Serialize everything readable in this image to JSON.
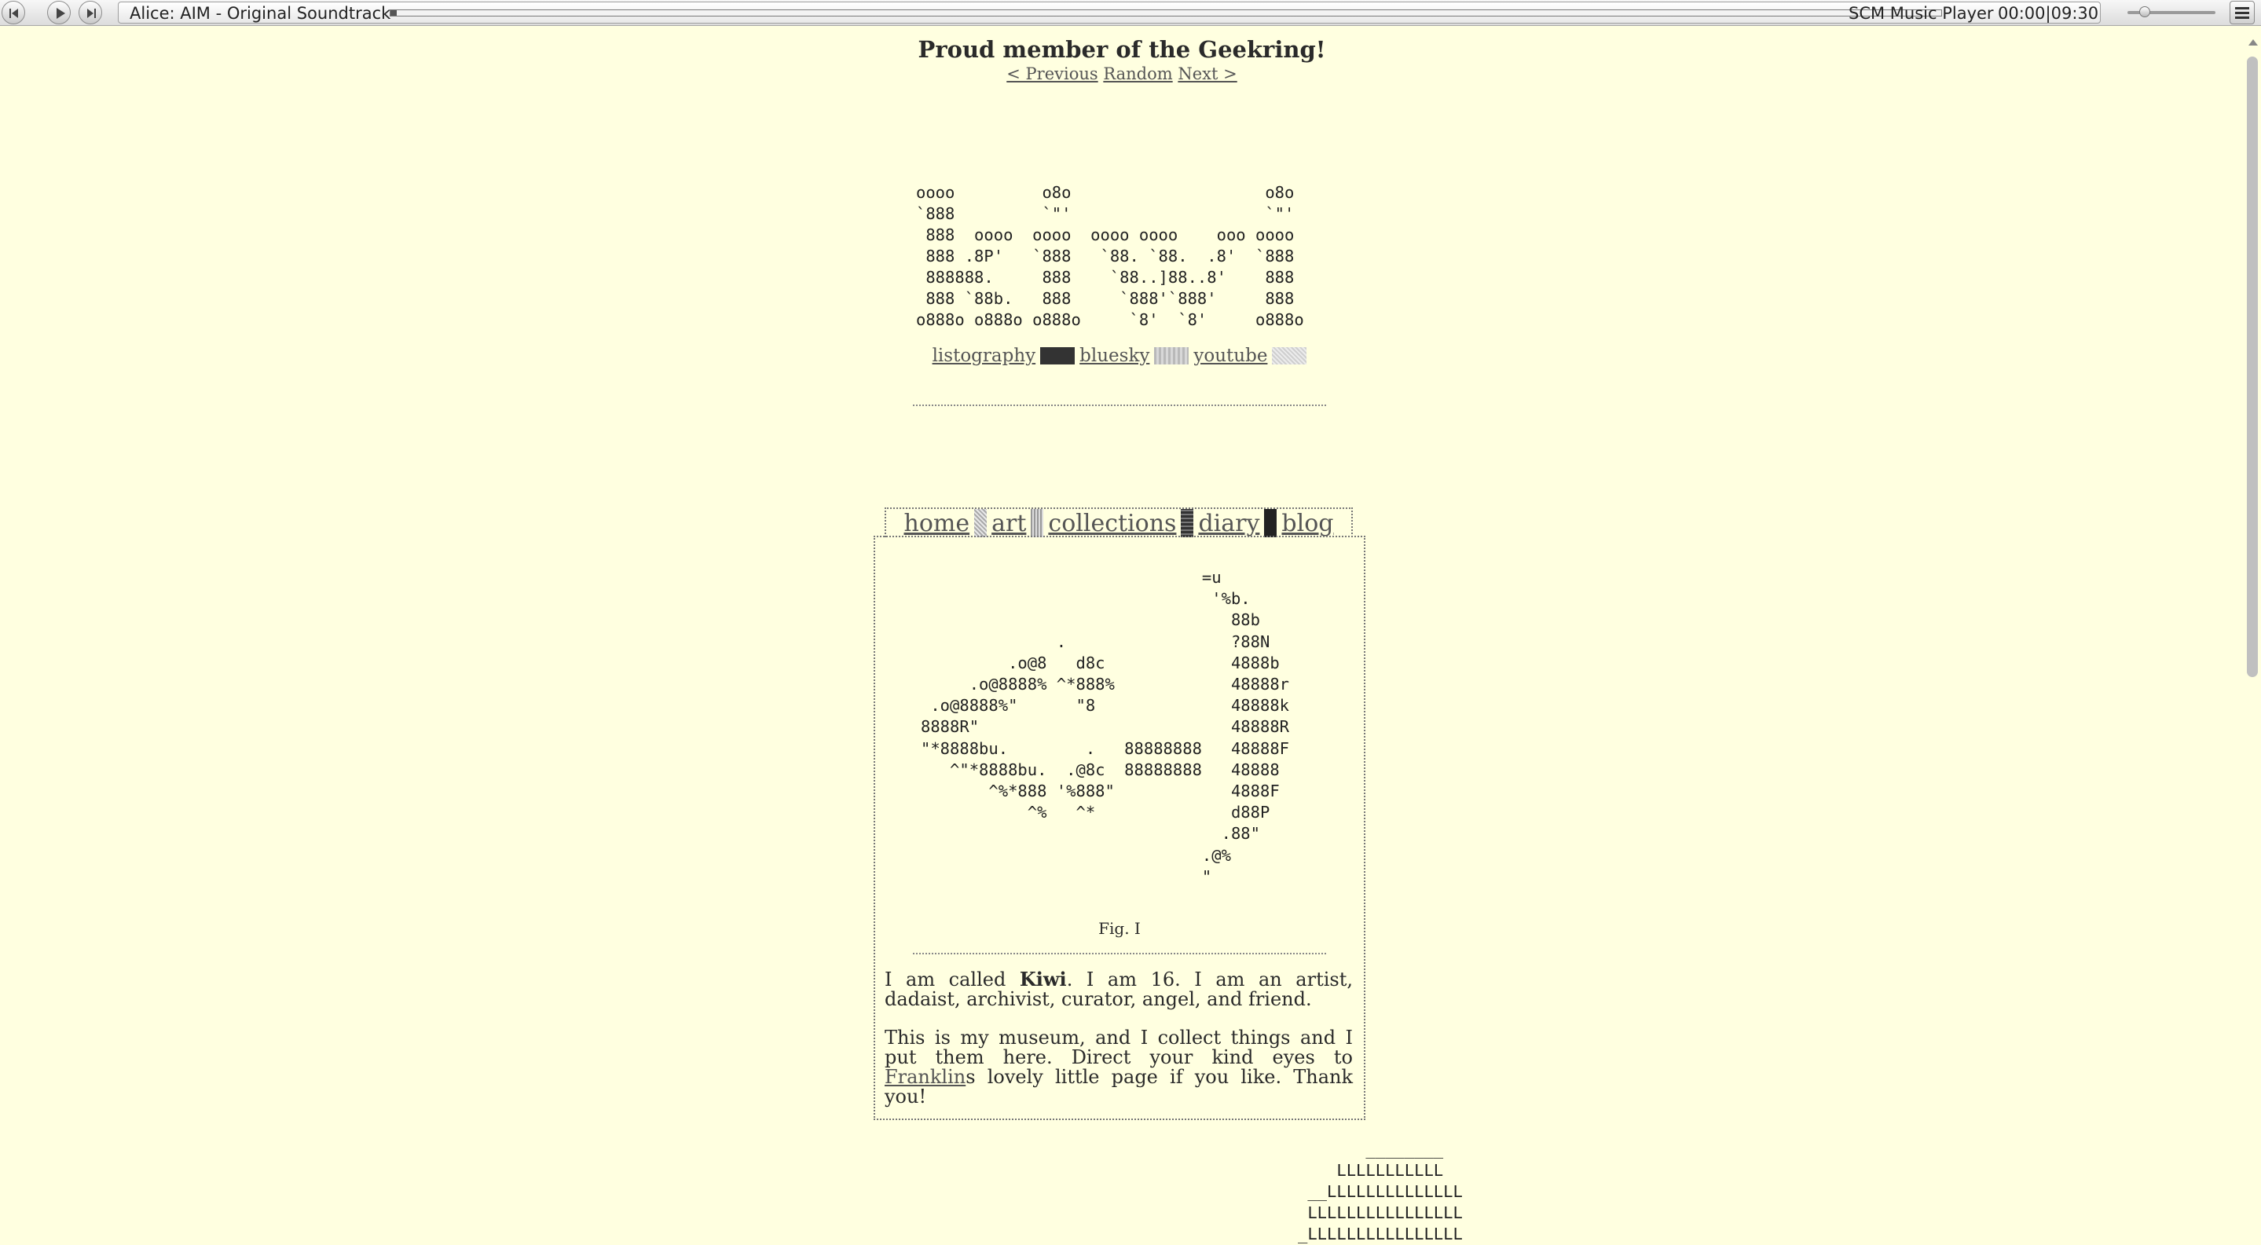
{
  "player": {
    "track_title": "Alice: AIM - Original Soundtrack",
    "player_name": "SCM Music Player",
    "time": "00:00|09:30",
    "progress_fraction": 0.004,
    "volume_fraction": 0.2
  },
  "geekring": {
    "title": "Proud member of the Geekring!",
    "previous": "< Previous",
    "random": "Random",
    "next": "Next >"
  },
  "logo_ascii": "oooo         o8o                    o8o\n`888         `\"'                    `\"'\n 888  oooo  oooo  oooo oooo    ooo oooo\n 888 .8P'   `888   `88. `88.  .8'  `888\n 888888.     888    `88..]88..8'    888\n 888 `88b.   888     `888'`888'     888\no888o o888o o888o     `8'  `8'     o888o",
  "social": {
    "links": [
      "listography",
      "bluesky",
      "youtube"
    ]
  },
  "nav": {
    "tabs": [
      "home",
      "art",
      "collections",
      "diary",
      "blog"
    ]
  },
  "kiwi_ascii": "                             =u\n                              '%b.\n                                88b\n              .                 ?88N\n         .o@8   d8c             4888b\n     .o@8888% ^*888%            48888r\n .o@8888%\"      \"8              48888k\n8888R\"                          48888R\n\"*8888bu.        .   88888888   48888F\n   ^\"*8888bu.  .@8c  88888888   48888\n       ^%*888 '%888\"            4888F\n           ^%   ^*              d88P\n                               .88\"\n                             .@%\n                             \"",
  "figure_caption": "Fig. I",
  "intro": {
    "p1_before": "I am called ",
    "p1_name": "Kiwi",
    "p1_after": ". I am 16. I am an artist, dadaist, archivist, curator, angel, and friend.",
    "p2_before": "This is my museum, and I collect things and I put them here. Direct your kind eyes to ",
    "p2_link": "Franklin",
    "p2_after": "s lovely little page if you like. Thank you!"
  },
  "bottom_ascii": "       ________\n    LLLLLLLLLLL\n __LLLLLLLLLLLLLL\n LLLLLLLLLLLLLLLL\n_LLLLLLLLLLLLLLLL"
}
